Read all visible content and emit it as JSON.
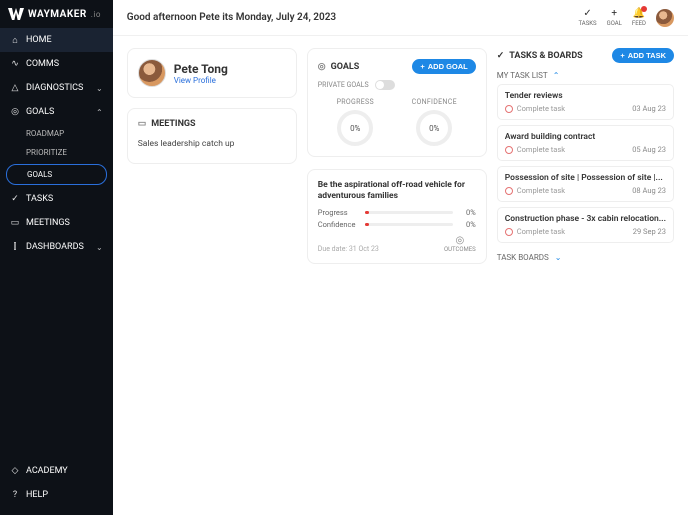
{
  "brand": {
    "name": "WAYMAKER",
    "suffix": ".io"
  },
  "nav": {
    "home": "HOME",
    "comms": "COMMS",
    "diagnostics": "DIAGNOSTICS",
    "goals": "GOALS",
    "goals_sub": {
      "roadmap": "ROADMAP",
      "prioritize": "PRIORITIZE",
      "goals": "GOALS"
    },
    "tasks": "TASKS",
    "meetings": "MEETINGS",
    "dashboards": "DASHBOARDS",
    "academy": "ACADEMY",
    "help": "HELP"
  },
  "topbar": {
    "greeting": "Good afternoon Pete its Monday, July 24, 2023",
    "tasks": "TASKS",
    "goal": "GOAL",
    "feed": "FEED"
  },
  "profile": {
    "name": "Pete Tong",
    "view": "View Profile"
  },
  "meetings": {
    "title": "MEETINGS",
    "items": [
      "Sales leadership catch up"
    ]
  },
  "goals": {
    "title": "GOALS",
    "add": "ADD GOAL",
    "private": "PRIVATE GOALS",
    "progress_label": "PROGRESS",
    "confidence_label": "CONFIDENCE",
    "progress_value": "0%",
    "confidence_value": "0%",
    "detail": {
      "title": "Be the aspirational off-road vehicle for adventurous families",
      "progress_label": "Progress",
      "confidence_label": "Confidence",
      "progress_val": "0%",
      "confidence_val": "0%",
      "due": "Due date: 31 Oct 23",
      "outcomes": "OUTCOMES"
    }
  },
  "tasks": {
    "title": "TASKS & BOARDS",
    "add": "ADD TASK",
    "list_title": "MY TASK LIST",
    "complete": "Complete task",
    "boards": "TASK BOARDS",
    "items": [
      {
        "title": "Tender reviews",
        "date": "03 Aug 23"
      },
      {
        "title": "Award building contract",
        "date": "05 Aug 23"
      },
      {
        "title": "Possession of site | Possession of site |...",
        "date": "08 Aug 23"
      },
      {
        "title": "Construction phase - 3x cabin relocation...",
        "date": "29 Sep 23"
      }
    ]
  }
}
